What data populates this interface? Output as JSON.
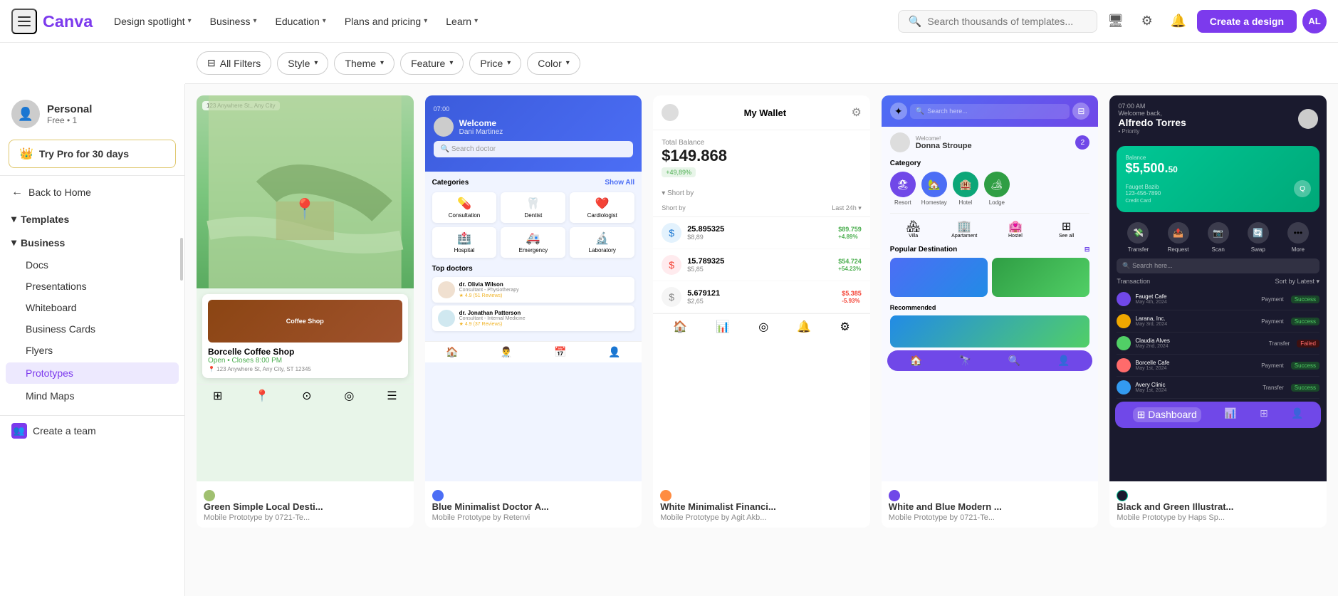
{
  "nav": {
    "hamburger_label": "menu",
    "logo_alt": "Canva",
    "links": [
      {
        "label": "Design spotlight",
        "id": "design-spotlight"
      },
      {
        "label": "Business",
        "id": "business"
      },
      {
        "label": "Education",
        "id": "education"
      },
      {
        "label": "Plans and pricing",
        "id": "plans-pricing"
      },
      {
        "label": "Learn",
        "id": "learn"
      }
    ],
    "search_placeholder": "Search thousands of templates...",
    "create_label": "Create a design",
    "avatar_initials": "AL"
  },
  "filters": {
    "all_filters": "All Filters",
    "style": "Style",
    "theme": "Theme",
    "feature": "Feature",
    "price": "Price",
    "color": "Color"
  },
  "sidebar": {
    "user_name": "Personal",
    "user_plan": "Free • 1",
    "pro_label": "Try Pro for 30 days",
    "back_home": "Back to Home",
    "templates_label": "Templates",
    "business_label": "Business",
    "items": [
      {
        "label": "Docs",
        "id": "docs"
      },
      {
        "label": "Presentations",
        "id": "presentations"
      },
      {
        "label": "Whiteboard",
        "id": "whiteboard"
      },
      {
        "label": "Business Cards",
        "id": "business-cards"
      },
      {
        "label": "Flyers",
        "id": "flyers"
      },
      {
        "label": "Prototypes",
        "id": "prototypes",
        "active": true
      },
      {
        "label": "Mind Maps",
        "id": "mind-maps"
      }
    ],
    "create_team": "Create a team"
  },
  "templates": [
    {
      "id": "card-1",
      "title": "Green Simple Local Desti...",
      "subtitle": "Mobile Prototype by 0721-Te...",
      "type": "map"
    },
    {
      "id": "card-2",
      "title": "Blue Minimalist Doctor A...",
      "subtitle": "Mobile Prototype by Retenvi",
      "type": "doctor"
    },
    {
      "id": "card-3",
      "title": "White Minimalist Financi...",
      "subtitle": "Mobile Prototype by Agit Akb...",
      "type": "finance-light"
    },
    {
      "id": "card-4",
      "title": "White and Blue Modern ...",
      "subtitle": "Mobile Prototype by 0721-Te...",
      "type": "travel"
    },
    {
      "id": "card-5",
      "title": "Black and Green Illustrat...",
      "subtitle": "Mobile Prototype by Haps Sp...",
      "type": "finance-dark"
    }
  ],
  "icons": {
    "search": "🔍",
    "monitor": "🖥",
    "gear": "⚙",
    "bell": "🔔",
    "crown": "👑",
    "back_arrow": "←",
    "chevron_down": "▾",
    "chevron_right": "›",
    "map_pin": "📍",
    "filter": "⊟",
    "team": "👥"
  }
}
